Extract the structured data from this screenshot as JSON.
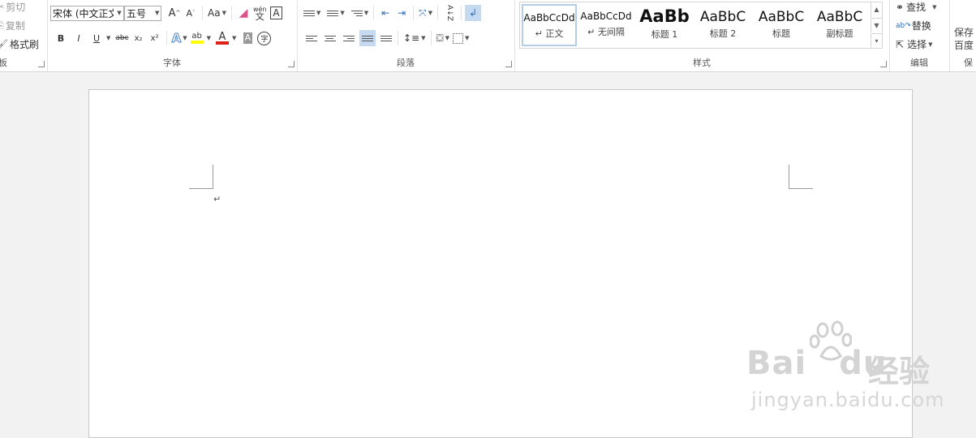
{
  "clipboard": {
    "cut": "剪切",
    "copy": "复制",
    "format_painter": "格式刷",
    "group_label": "板"
  },
  "font": {
    "name_value": "宋体 (中文正文",
    "size_value": "五号",
    "grow": "A",
    "shrink": "A",
    "change_case": "Aa",
    "phonetic": "wén",
    "phonetic_char": "文",
    "border_char": "A",
    "bold": "B",
    "italic": "I",
    "underline": "U",
    "strike": "abc",
    "subscript": "x₂",
    "superscript": "x²",
    "text_effect": "A",
    "highlight": "ab",
    "font_color": "A",
    "char_shading": "A",
    "enclose": "字",
    "group_label": "字体",
    "highlight_color": "#ffff00",
    "font_color_value": "#e0201b"
  },
  "paragraph": {
    "sort": "A↓Z",
    "group_label": "段落"
  },
  "styles": {
    "items": [
      {
        "sample": "AaBbCcDd",
        "name": "↵ 正文"
      },
      {
        "sample": "AaBbCcDd",
        "name": "↵ 无间隔"
      },
      {
        "sample": "AaBb",
        "name": "标题 1"
      },
      {
        "sample": "AaBbC",
        "name": "标题 2"
      },
      {
        "sample": "AaBbC",
        "name": "标题"
      },
      {
        "sample": "AaBbC",
        "name": "副标题"
      }
    ],
    "group_label": "样式"
  },
  "editing": {
    "find": "查找",
    "replace": "替换",
    "select": "选择",
    "group_label": "编辑"
  },
  "save": {
    "line1": "保存",
    "line2": "百度",
    "group_label": "保"
  },
  "document": {
    "paragraph_mark": "↵"
  },
  "watermark": {
    "brand": "Bai",
    "brand_tail": "du",
    "cn": "经验",
    "url": "jingyan.baidu.com"
  }
}
